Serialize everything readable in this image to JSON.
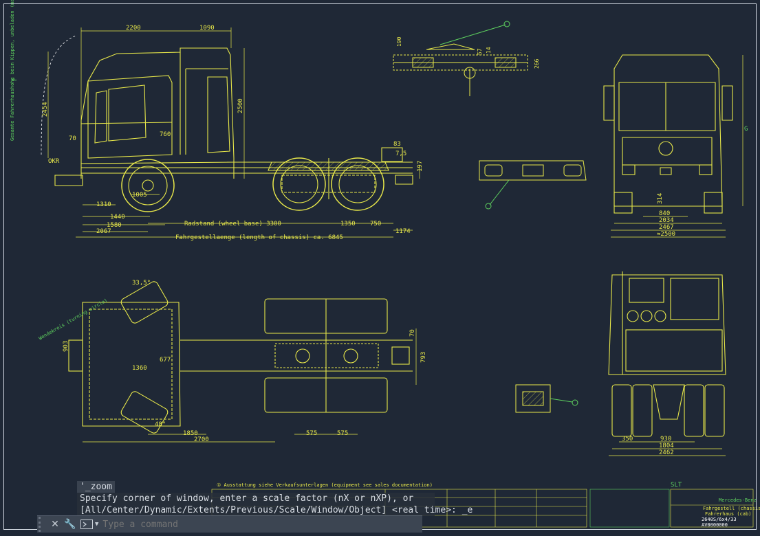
{
  "colors": {
    "background": "#1f2836",
    "drawing": "#e8e84a",
    "annotation": "#f0f0a0",
    "accent": "#5fd35f",
    "command_text": "#d8dde4"
  },
  "dimensions": {
    "d2200": "2200",
    "d1090": "1090",
    "d2500": "2500",
    "d760": "760",
    "d70": "70",
    "d1005": "1005",
    "d1310": "1310",
    "d1440": "1440",
    "d1580": "1580",
    "d2067": "2067",
    "wheelbase": "Radstand (wheel base) 3300",
    "d1350": "1350",
    "d750": "750",
    "d1174": "1174",
    "chassis_length": "Fahrgestellaenge (length of chassis) ca. 6845",
    "d2454": "2454",
    "okr": "OKR",
    "d83": "83",
    "d75": "7,5",
    "d197": "197",
    "d190": "190",
    "d57": "57",
    "d14": "14",
    "d266": "266",
    "d840": "840",
    "d2034": "2034",
    "d2467": "2467",
    "d2500b": "≈2500",
    "d314": "314",
    "g_label": "G",
    "f_label": "F",
    "angle": "33,5°",
    "d677": "677",
    "d1360": "1360",
    "d1850": "1850",
    "d2700": "2700",
    "d575a": "575",
    "d575b": "575",
    "d48": "48°",
    "d70b": "70",
    "d793": "793",
    "d903": "903",
    "d350": "350",
    "d930": "930",
    "d1804": "1804",
    "d2462": "2462",
    "slt": "SLT"
  },
  "notes": {
    "left_vertical": "Gesamte Fahrerhaushohe beim Kippen, unbeladen (max. height over cab during tilting/vehicle unladen)",
    "turning_circle": "Wendekreis (turning circle)",
    "footnote": "① Ausstattung siehe Verkaufsunterlagen (equipment see sales documentation)"
  },
  "title_block": {
    "title1": "Fahrgestell (chassis)",
    "title2": "Fahrerhaus (cab)",
    "model": "2640S/6x4/33",
    "drawing_no": "AV0000000",
    "company": "Mercedes-Benz"
  },
  "command_line": {
    "history_head": "'_zoom",
    "history_1": "Specify corner of window, enter a scale factor (nX or nXP), or",
    "history_2": "[All/Center/Dynamic/Extents/Previous/Scale/Window/Object] <real time>: _e",
    "input_value": "",
    "input_placeholder": "Type a command"
  }
}
